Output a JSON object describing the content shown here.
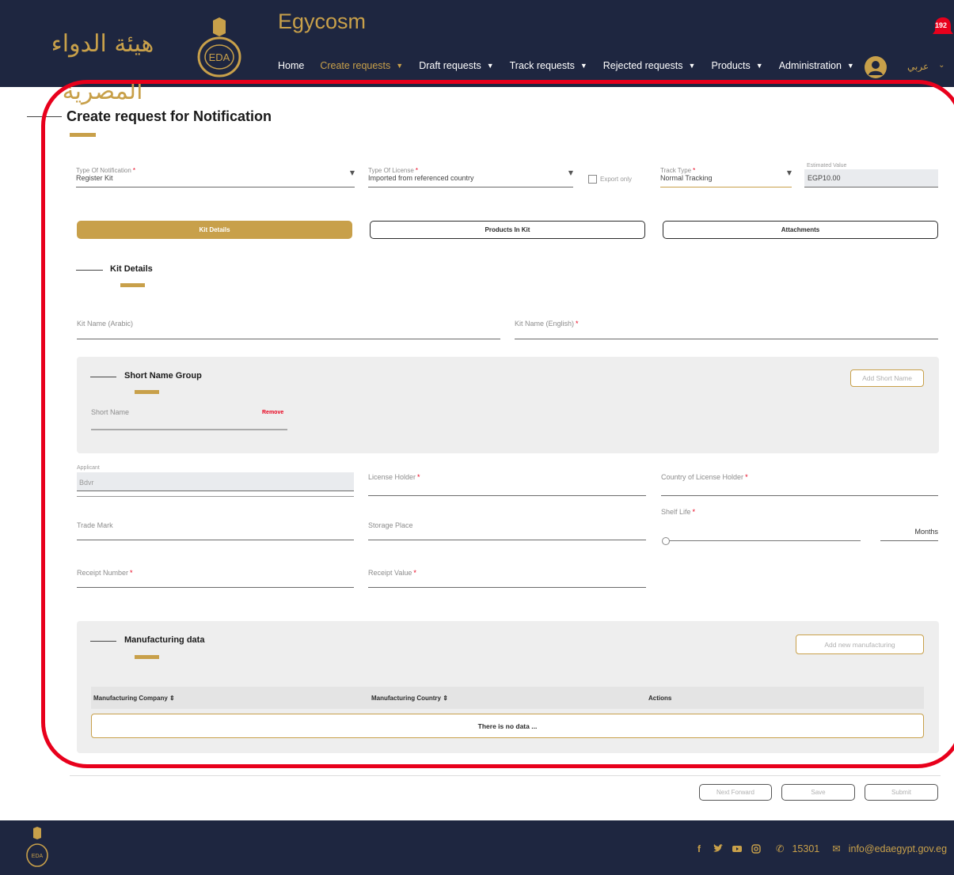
{
  "header": {
    "logo_arabic": "هيئة الدواء المصرية",
    "seal_text": "EDA",
    "app_title": "Egycosm",
    "notification_count": "192",
    "language_label": "عربي",
    "nav": [
      {
        "label": "Home"
      },
      {
        "label": "Create requests"
      },
      {
        "label": "Draft requests"
      },
      {
        "label": "Track requests"
      },
      {
        "label": "Rejected requests"
      },
      {
        "label": "Products"
      },
      {
        "label": "Administration"
      }
    ]
  },
  "page": {
    "title": "Create request for Notification"
  },
  "top_fields": {
    "notification_type": {
      "label": "Type Of Notification",
      "value": "Register Kit"
    },
    "license_type": {
      "label": "Type Of License",
      "value": "Imported from referenced country"
    },
    "export_only": {
      "label": "Export only"
    },
    "track_type": {
      "label": "Track Type",
      "value": "Normal Tracking"
    },
    "estimated_value": {
      "label": "Estimated Value",
      "value": "EGP10.00"
    }
  },
  "tabs": [
    {
      "label": "Kit Details"
    },
    {
      "label": "Products In Kit"
    },
    {
      "label": "Attachments"
    }
  ],
  "kit_details": {
    "title": "Kit Details",
    "kit_name_arabic": {
      "label": "Kit Name (Arabic)"
    },
    "kit_name_english": {
      "label": "Kit Name (English)"
    }
  },
  "short_name_group": {
    "title": "Short Name Group",
    "add_label": "Add Short Name",
    "field_label": "Short Name",
    "remove_label": "Remove"
  },
  "details": {
    "applicant": {
      "label": "Applicant",
      "value": "Bdvr"
    },
    "license_holder": {
      "label": "License Holder"
    },
    "country_license_holder": {
      "label": "Country of License Holder"
    },
    "trade_mark": {
      "label": "Trade Mark"
    },
    "storage_place": {
      "label": "Storage Place"
    },
    "shelf_life": {
      "label": "Shelf Life",
      "unit": "Months",
      "value": 0
    },
    "receipt_number": {
      "label": "Receipt Number"
    },
    "receipt_value": {
      "label": "Receipt Value"
    }
  },
  "manufacturing": {
    "title": "Manufacturing data",
    "add_label": "Add new manufacturing",
    "columns": [
      "Manufacturing Company ⇕",
      "Manufacturing Country ⇕",
      "Actions"
    ],
    "empty_text": "There is no data ..."
  },
  "actions": {
    "next_forward": "Next Forward",
    "save": "Save",
    "submit": "Submit"
  },
  "footer": {
    "phone": "15301",
    "email": "info@edaegypt.gov.eg"
  },
  "colors": {
    "navy": "#1e2640",
    "gold": "#c8a04a",
    "required": "#e8001c",
    "annotation": "#e8001c"
  }
}
